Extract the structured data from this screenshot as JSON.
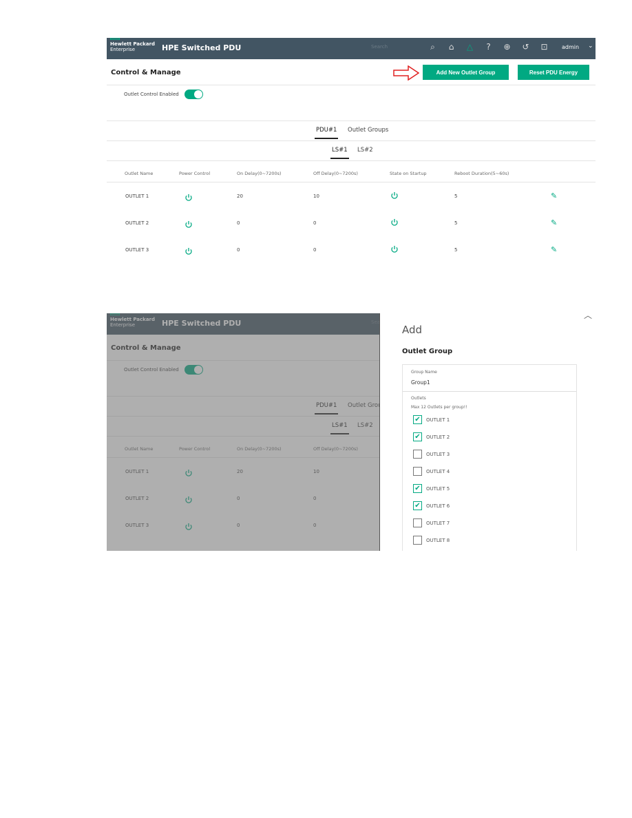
{
  "header": {
    "brand_line1": "Hewlett Packard",
    "brand_line2": "Enterprise",
    "title": "HPE Switched PDU",
    "search_placeholder": "Search",
    "user": "admin",
    "icons": [
      "search-icon",
      "home-icon",
      "alert-icon",
      "help-icon",
      "globe-icon",
      "history-icon",
      "pdu-icon"
    ]
  },
  "page": {
    "title": "Control & Manage",
    "add_group_button": "Add New Outlet Group",
    "reset_energy_button": "Reset PDU Energy",
    "outlet_control_label": "Outlet Control Enabled",
    "outlet_control_enabled": true
  },
  "tabs": [
    {
      "label": "PDU#1",
      "active": true
    },
    {
      "label": "Outlet Groups",
      "active": false
    }
  ],
  "subtabs": [
    {
      "label": "LS#1",
      "active": true
    },
    {
      "label": "LS#2",
      "active": false
    }
  ],
  "table": {
    "columns": [
      "Outlet Name",
      "Power Control",
      "On Delay(0~7200s)",
      "Off Delay(0~7200s)",
      "State on Startup",
      "Reboot Duration(5~60s)"
    ],
    "rows": [
      {
        "name": "OUTLET 1",
        "on_delay": "20",
        "off_delay": "10",
        "reboot": "5"
      },
      {
        "name": "OUTLET 2",
        "on_delay": "0",
        "off_delay": "0",
        "reboot": "5"
      },
      {
        "name": "OUTLET 3",
        "on_delay": "0",
        "off_delay": "0",
        "reboot": "5"
      }
    ]
  },
  "dialog": {
    "title": "Add",
    "subtitle": "Outlet Group",
    "group_name_label": "Group Name",
    "group_name_value": "Group1",
    "outlets_label": "Outlets",
    "outlets_hint": "Max 12 Outlets per group!!",
    "outlets": [
      {
        "label": "OUTLET 1",
        "checked": true
      },
      {
        "label": "OUTLET 2",
        "checked": true
      },
      {
        "label": "OUTLET 3",
        "checked": false
      },
      {
        "label": "OUTLET 4",
        "checked": false
      },
      {
        "label": "OUTLET 5",
        "checked": true
      },
      {
        "label": "OUTLET 6",
        "checked": true
      },
      {
        "label": "OUTLET 7",
        "checked": false
      },
      {
        "label": "OUTLET 8",
        "checked": false
      }
    ]
  },
  "colors": {
    "accent": "#01a982",
    "header": "#425563",
    "arrow": "#e02020"
  }
}
